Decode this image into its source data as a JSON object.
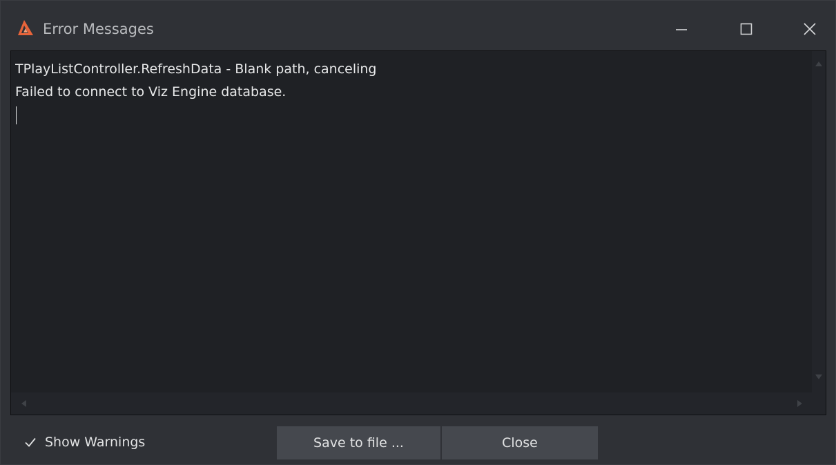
{
  "window": {
    "title": "Error Messages",
    "icons": {
      "app": "app-logo-icon",
      "minimize": "minimize-icon",
      "maximize": "maximize-icon",
      "close": "close-icon"
    }
  },
  "log": {
    "lines": [
      "TPlayListController.RefreshData - Blank path, canceling",
      "Failed to connect to Viz Engine database."
    ]
  },
  "footer": {
    "show_warnings_label": "Show Warnings",
    "show_warnings_checked": true,
    "save_label": "Save to file ...",
    "close_label": "Close"
  },
  "colors": {
    "logo_accent": "#e8643a",
    "background": "#2f3136",
    "log_background": "#1f2125",
    "button": "#45484e"
  }
}
